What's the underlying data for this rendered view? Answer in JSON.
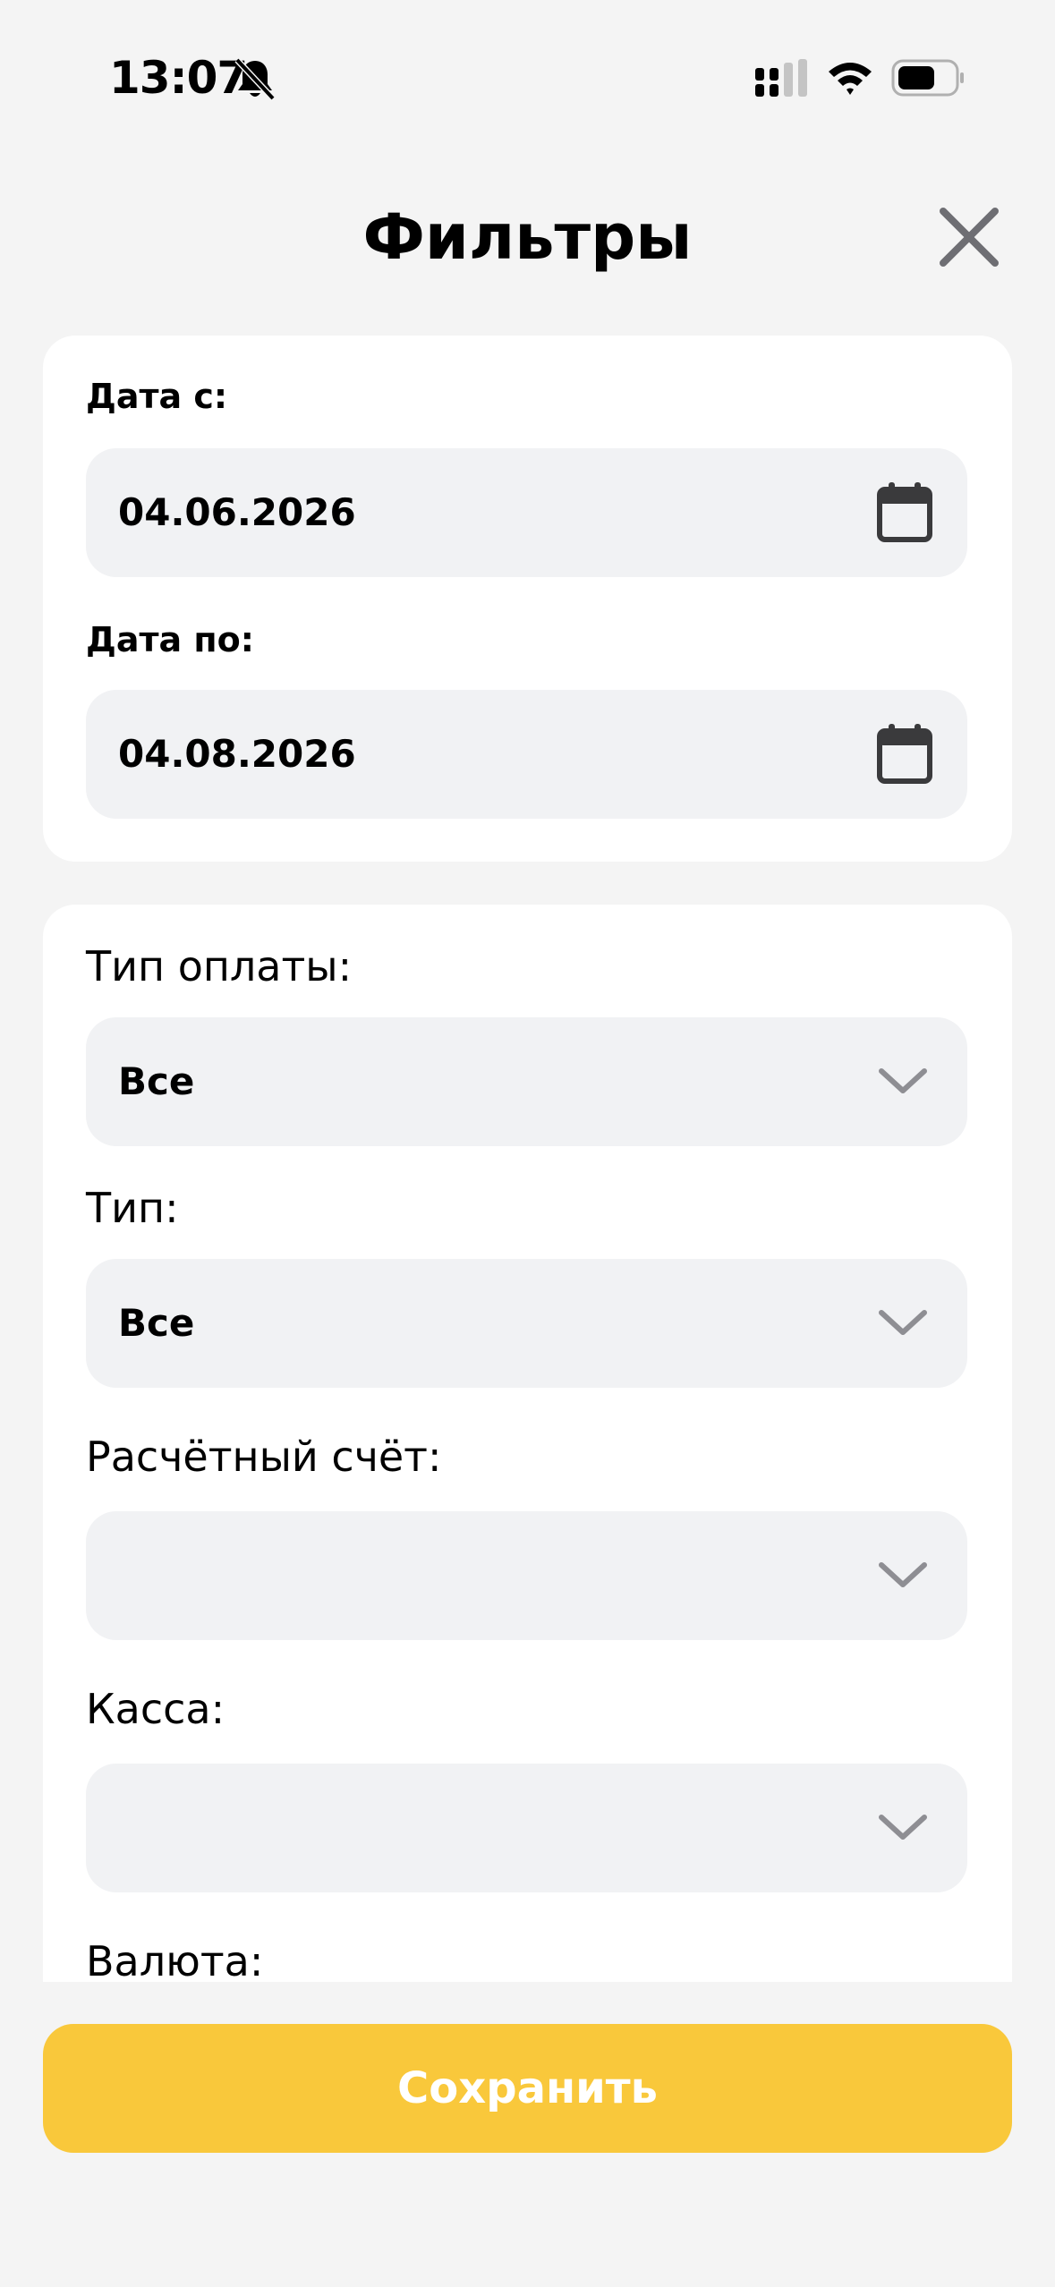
{
  "status_bar": {
    "time": "13:07",
    "icons": [
      "bell-slash-icon",
      "signal-icon",
      "wifi-icon",
      "battery-icon"
    ]
  },
  "header": {
    "title": "Фильтры",
    "close_icon": "close-icon"
  },
  "date_section": {
    "date_from_label": "Дата с:",
    "date_from_value": "04.06.2026",
    "date_to_label": "Дата по:",
    "date_to_value": "04.08.2026"
  },
  "filters": {
    "payment_type_label": "Тип оплаты:",
    "payment_type_value": "Все",
    "type_label": "Тип:",
    "type_value": "Все",
    "account_label": "Расчётный счёт:",
    "account_value": "",
    "cashbox_label": "Касса:",
    "cashbox_value": "",
    "currency_label": "Валюта:"
  },
  "footer": {
    "save_label": "Сохранить"
  },
  "colors": {
    "background": "#f4f4f4",
    "card": "#ffffff",
    "field": "#f1f2f4",
    "accent": "#f9c83b",
    "icon_gray": "#8e8e93"
  }
}
